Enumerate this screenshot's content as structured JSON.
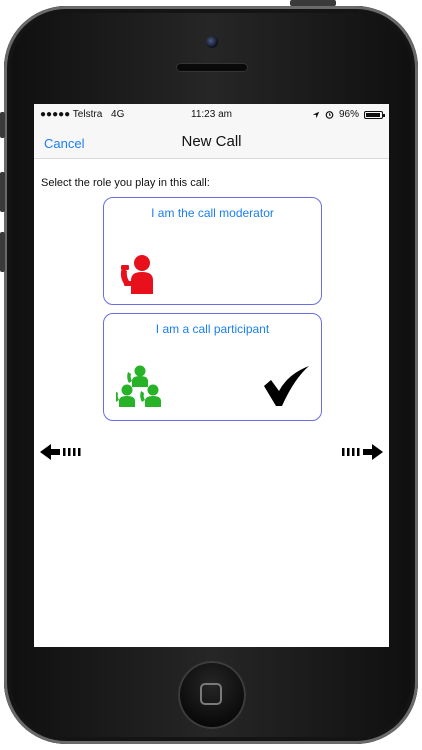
{
  "status_bar": {
    "carrier": "●●●●● Telstra",
    "network": "4G",
    "time": "11:23 am",
    "battery": "96%"
  },
  "nav": {
    "cancel_label": "Cancel",
    "title": "New Call"
  },
  "instruction": "Select the role you play in this call:",
  "roles": [
    {
      "label": "I am the call moderator",
      "icon": "moderator-icon",
      "color": "#e8101a",
      "selected": false
    },
    {
      "label": "I am a call participant",
      "icon": "participants-icon",
      "color": "#27b227",
      "selected": true
    }
  ],
  "colors": {
    "accent": "#1a7ff0",
    "card_border": "#6a6ee6"
  }
}
